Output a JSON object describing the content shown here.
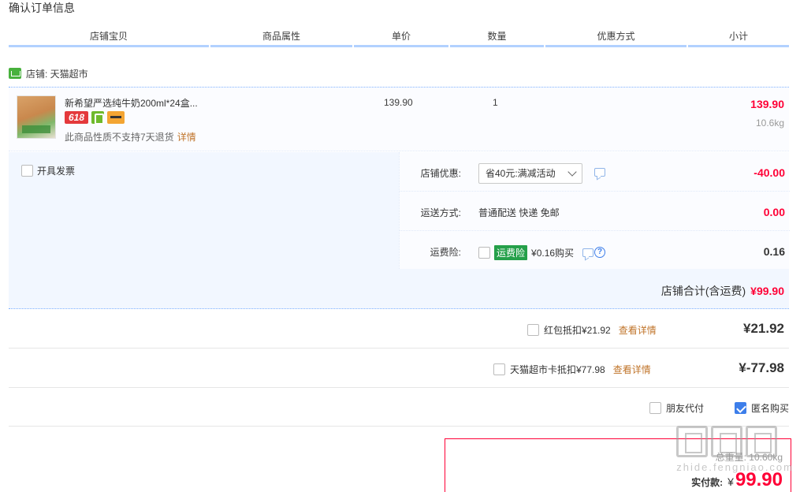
{
  "page": {
    "title": "确认订单信息"
  },
  "columns": [
    "店铺宝贝",
    "商品属性",
    "单价",
    "数量",
    "优惠方式",
    "小计"
  ],
  "shop": {
    "label": "店铺: 天猫超市"
  },
  "item": {
    "title": "新希望严选纯牛奶200ml*24盒...",
    "badge_618": "618",
    "note": "此商品性质不支持7天退货",
    "note_link": "详情",
    "unit_price": "139.90",
    "quantity": "1",
    "subtotal": "139.90",
    "weight": "10.6kg"
  },
  "options": {
    "invoice_label": "开具发票",
    "discount": {
      "label": "店铺优惠:",
      "selected": "省40元:满减活动",
      "value": "-40.00"
    },
    "shipping": {
      "label": "运送方式:",
      "text": "普通配送 快递 免邮",
      "value": "0.00"
    },
    "insurance": {
      "label": "运费险:",
      "tag": "运费险",
      "text": "¥0.16购买",
      "help": "?",
      "value": "0.16"
    },
    "shop_total_label": "店铺合计(含运费)",
    "shop_total_value": "¥99.90"
  },
  "deductions": [
    {
      "label": "红包抵扣¥21.92",
      "link": "查看详情",
      "amount": "¥21.92"
    },
    {
      "label": "天猫超市卡抵扣¥77.98",
      "link": "查看详情",
      "amount": "¥-77.98"
    }
  ],
  "extra": {
    "friend_pay": "朋友代付",
    "anonymous": "匿名购买",
    "anonymous_checked": true
  },
  "payment": {
    "weight": "总重量: 10.60kg",
    "label": "实付款:",
    "currency": "¥",
    "value": "99.90"
  },
  "watermark": {
    "url": "zhide.fengniao.com"
  },
  "colors": {
    "price_red": "#ff0036",
    "header_border": "#b2d1ff",
    "panel_bg": "#f2f7ff",
    "link": "#c0742a",
    "insurance_green": "#25a04a"
  }
}
